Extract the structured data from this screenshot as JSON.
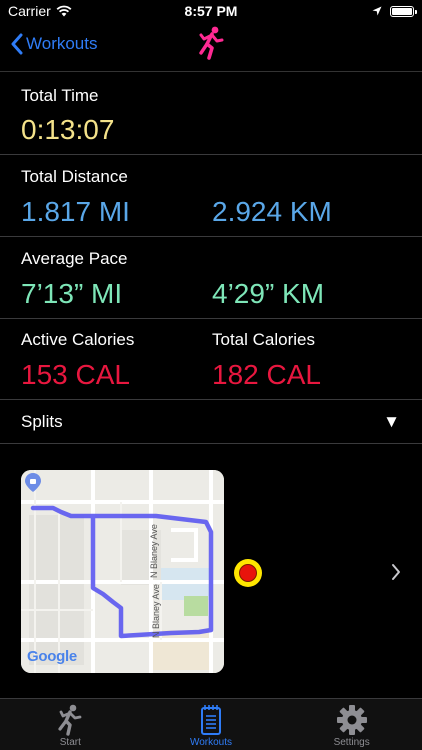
{
  "status_bar": {
    "carrier": "Carrier",
    "time": "8:57 PM"
  },
  "nav": {
    "back_label": "Workouts"
  },
  "metrics": {
    "total_time": {
      "label": "Total Time",
      "value": "0:13:07"
    },
    "total_distance": {
      "label": "Total Distance",
      "miles": "1.817 MI",
      "km": "2.924 KM"
    },
    "average_pace": {
      "label": "Average Pace",
      "per_mile": "7’13” MI",
      "per_km": "4’29” KM"
    },
    "active_calories": {
      "label": "Active Calories",
      "value": "153 CAL"
    },
    "total_calories": {
      "label": "Total Calories",
      "value": "182 CAL"
    }
  },
  "splits": {
    "label": "Splits",
    "toggle_glyph": "▼"
  },
  "map": {
    "street_upper": "N Blaney Ave",
    "street_lower": "N Blaney Ave",
    "attribution": "Google"
  },
  "tabs": [
    {
      "label": "Start",
      "icon": "runner-icon",
      "active": false
    },
    {
      "label": "Workouts",
      "icon": "notebook-icon",
      "active": true
    },
    {
      "label": "Settings",
      "icon": "gear-icon",
      "active": false
    }
  ],
  "colors": {
    "time": "#f4e28a",
    "distance": "#5aa7e8",
    "pace": "#7ee6b8",
    "calories": "#e8173f",
    "accent": "#2f7cf6",
    "title_icon": "#ff2a93",
    "route": "#5b58f0"
  }
}
